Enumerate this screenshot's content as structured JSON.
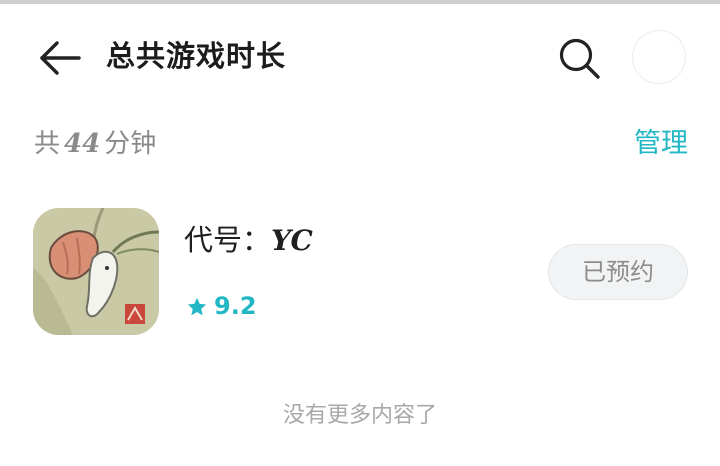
{
  "header": {
    "title": "总共游戏时长",
    "back_icon": "arrow-left-icon",
    "search_icon": "search-icon"
  },
  "summary": {
    "prefix": "共",
    "minutes": "44",
    "suffix": "分钟",
    "manage_label": "管理"
  },
  "game": {
    "name_prefix": "代号：",
    "name_code": "YC",
    "rating": "9.2",
    "rating_icon": "star-icon",
    "button_label": "已预约"
  },
  "footer": {
    "text": "没有更多内容了"
  },
  "colors": {
    "accent": "#22b7c4",
    "muted_text": "#8a8a8a",
    "button_bg": "#f1f3f4"
  }
}
